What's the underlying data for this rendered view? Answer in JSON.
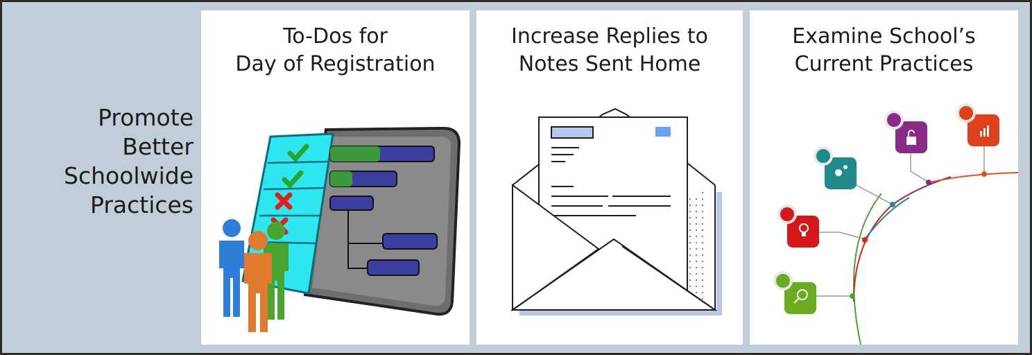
{
  "side_title": {
    "lines": [
      "Promote",
      "Better",
      "Schoolwide",
      "Practices"
    ]
  },
  "cards": [
    {
      "title_lines": [
        "To-Dos for",
        "Day of Registration"
      ],
      "illustration": "gantt-checklist-with-people"
    },
    {
      "title_lines": [
        "Increase Replies to",
        "Notes Sent Home"
      ],
      "illustration": "open-envelope-with-letter"
    },
    {
      "title_lines": [
        "Examine School’s",
        "Current Practices"
      ],
      "illustration": "business-icons-timeline-arc"
    }
  ],
  "colors": {
    "background": "#c1cdd9",
    "frame": "#2b2b2b",
    "card": "#ffffff",
    "checklist": "#2ee6f0",
    "gantt_panel": "#6b6b6b"
  }
}
